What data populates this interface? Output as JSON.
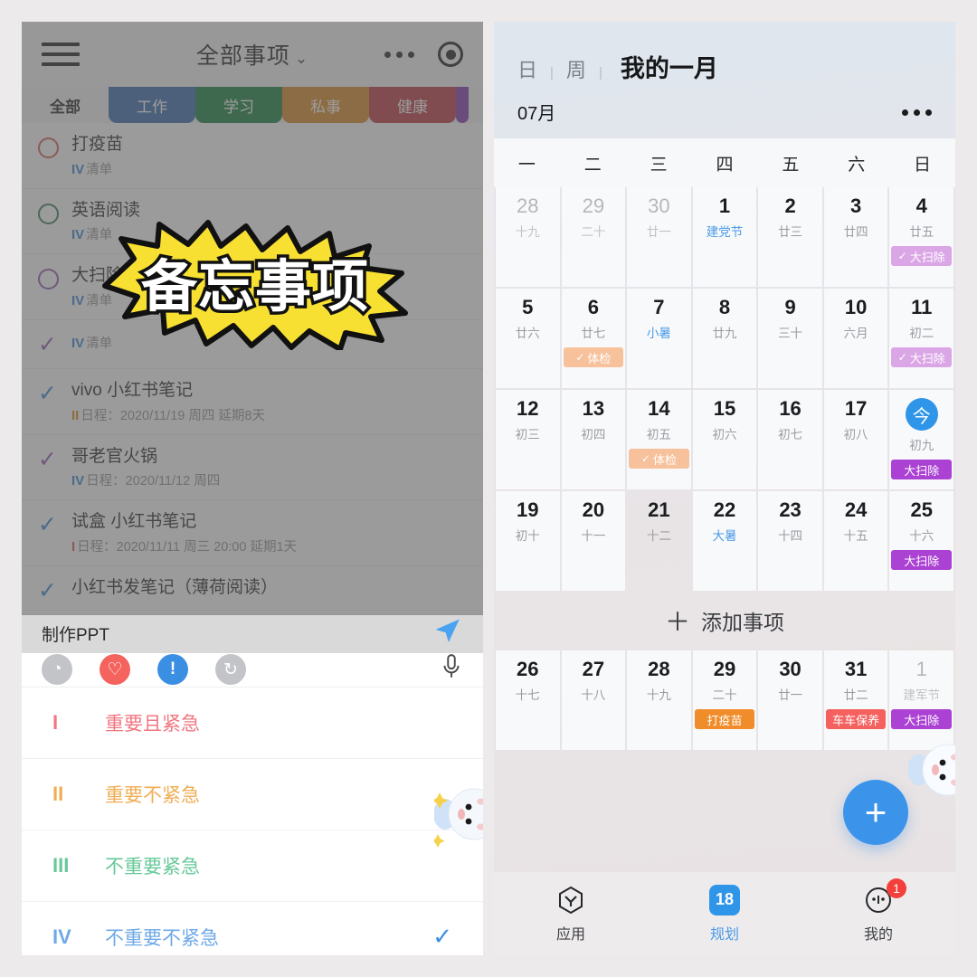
{
  "left": {
    "topbar": {
      "menu_icon": "hamburger-icon",
      "title": "全部事项",
      "chevron": "⌄",
      "more_icon": "more-dots-icon",
      "record_icon": "target-circle-icon"
    },
    "tabs": [
      {
        "label": "全部",
        "color": "#f2f2f2",
        "active": true
      },
      {
        "label": "工作",
        "color": "#2f62a8",
        "active": false
      },
      {
        "label": "学习",
        "color": "#0c7a34",
        "active": false
      },
      {
        "label": "私事",
        "color": "#d4821a",
        "active": false
      },
      {
        "label": "健康",
        "color": "#b52f35",
        "active": false
      }
    ],
    "tasks": [
      {
        "name": "打疫苗",
        "meta_rn": "IV",
        "meta": "清单",
        "state": "circle",
        "color": "#d2544e"
      },
      {
        "name": "英语阅读",
        "meta_rn": "IV",
        "meta": "清单",
        "state": "circle",
        "color": "#2f7a4a"
      },
      {
        "name": "大扫除",
        "meta_rn": "IV",
        "meta": "清单",
        "state": "circle",
        "color": "#8e4fb0"
      },
      {
        "name": "",
        "meta_rn": "IV",
        "meta": "清单",
        "state": "check",
        "color": "#8e4fb0"
      },
      {
        "name": "vivo 小红书笔记",
        "meta_rn": "II",
        "meta": "日程：2020/11/19 周四 延期8天",
        "state": "check",
        "color": "#2f7fd0"
      },
      {
        "name": "哥老官火锅",
        "meta_rn": "IV",
        "meta": "日程：2020/11/12 周四",
        "state": "check",
        "color": "#8e4fb0"
      },
      {
        "name": "试盒 小红书笔记",
        "meta_rn": "I",
        "meta": "日程：2020/11/11 周三 20:00 延期1天",
        "state": "check",
        "color": "#2f7fd0"
      },
      {
        "name": "小红书发笔记（薄荷阅读）",
        "meta_rn": "",
        "meta": "",
        "state": "check",
        "color": "#2f7fd0"
      }
    ],
    "sticker_text": "备忘事项",
    "input": {
      "value": "制作PPT",
      "send_icon": "send-paper-plane-icon"
    },
    "quick_icons": [
      {
        "name": "clock-icon",
        "glyph": "◔",
        "style": "gray"
      },
      {
        "name": "heart-icon",
        "glyph": "♡",
        "style": "red"
      },
      {
        "name": "priority-exclamation-icon",
        "glyph": "!",
        "style": "blue"
      },
      {
        "name": "repeat-icon",
        "glyph": "↻",
        "style": "gray"
      }
    ],
    "mic_icon": "microphone-icon",
    "priorities": [
      {
        "rn": "I",
        "label": "重要且紧急",
        "color": "#f07781",
        "selected": false
      },
      {
        "rn": "II",
        "label": "重要不紧急",
        "color": "#f0ad55",
        "selected": false
      },
      {
        "rn": "III",
        "label": "不重要紧急",
        "color": "#67c99a",
        "selected": false
      },
      {
        "rn": "IV",
        "label": "不重要不紧急",
        "color": "#6fa9e8",
        "selected": true
      }
    ],
    "selected_check": "✓"
  },
  "right": {
    "header": {
      "view_day": "日",
      "view_week": "周",
      "title": "我的一月",
      "month": "07",
      "month_unit": "月",
      "more_icon": "more-dots-icon"
    },
    "weekdays": [
      "一",
      "二",
      "三",
      "四",
      "五",
      "六",
      "日"
    ],
    "add_item": {
      "plus": "＋",
      "label": "添加事项"
    },
    "calendar": [
      [
        {
          "d": "28",
          "lunar": "十九",
          "out": true
        },
        {
          "d": "29",
          "lunar": "二十",
          "out": true
        },
        {
          "d": "30",
          "lunar": "廿一",
          "out": true
        },
        {
          "d": "1",
          "lunar": "建党节",
          "hl": true
        },
        {
          "d": "2",
          "lunar": "廿三"
        },
        {
          "d": "3",
          "lunar": "廿四"
        },
        {
          "d": "4",
          "lunar": "廿五",
          "events": [
            {
              "t": "大扫除",
              "c": "purple-l",
              "done": true
            }
          ]
        }
      ],
      [
        {
          "d": "5",
          "lunar": "廿六"
        },
        {
          "d": "6",
          "lunar": "廿七",
          "events": [
            {
              "t": "体检",
              "c": "orange-l",
              "done": true
            }
          ]
        },
        {
          "d": "7",
          "lunar": "小暑",
          "hl": true
        },
        {
          "d": "8",
          "lunar": "廿九"
        },
        {
          "d": "9",
          "lunar": "三十"
        },
        {
          "d": "10",
          "lunar": "六月"
        },
        {
          "d": "11",
          "lunar": "初二",
          "events": [
            {
              "t": "大扫除",
              "c": "purple-l",
              "done": true
            }
          ]
        }
      ],
      [
        {
          "d": "12",
          "lunar": "初三"
        },
        {
          "d": "13",
          "lunar": "初四"
        },
        {
          "d": "14",
          "lunar": "初五",
          "events": [
            {
              "t": "体检",
              "c": "orange-l",
              "done": true
            }
          ]
        },
        {
          "d": "15",
          "lunar": "初六"
        },
        {
          "d": "16",
          "lunar": "初七"
        },
        {
          "d": "17",
          "lunar": "初八"
        },
        {
          "d": "今",
          "lunar": "初九",
          "today": true,
          "events": [
            {
              "t": "大扫除",
              "c": "purple"
            }
          ]
        }
      ],
      [
        {
          "d": "19",
          "lunar": "初十"
        },
        {
          "d": "20",
          "lunar": "十一"
        },
        {
          "d": "21",
          "lunar": "十二",
          "shaded": true
        },
        {
          "d": "22",
          "lunar": "大暑",
          "hl": true
        },
        {
          "d": "23",
          "lunar": "十四"
        },
        {
          "d": "24",
          "lunar": "十五"
        },
        {
          "d": "25",
          "lunar": "十六",
          "events": [
            {
              "t": "大扫除",
              "c": "purple"
            }
          ]
        }
      ],
      [
        {
          "d": "26",
          "lunar": "十七"
        },
        {
          "d": "27",
          "lunar": "十八"
        },
        {
          "d": "28",
          "lunar": "十九"
        },
        {
          "d": "29",
          "lunar": "二十",
          "events": [
            {
              "t": "打疫苗",
              "c": "orange"
            }
          ]
        },
        {
          "d": "30",
          "lunar": "廿一"
        },
        {
          "d": "31",
          "lunar": "廿二",
          "events": [
            {
              "t": "车车保养",
              "c": "red"
            }
          ]
        },
        {
          "d": "1",
          "lunar": "建军节",
          "hl": true,
          "out": true,
          "events": [
            {
              "t": "大扫除",
              "c": "purple"
            }
          ]
        }
      ]
    ],
    "fab": {
      "icon": "plus-icon",
      "glyph": "+"
    },
    "bottom_nav": [
      {
        "label": "应用",
        "icon": "hexagon-apps-icon",
        "active": false
      },
      {
        "label": "规划",
        "icon": "calendar-18-icon",
        "badge_num": "18",
        "active": true
      },
      {
        "label": "我的",
        "icon": "profile-face-icon",
        "badge": "1",
        "active": false
      }
    ]
  }
}
